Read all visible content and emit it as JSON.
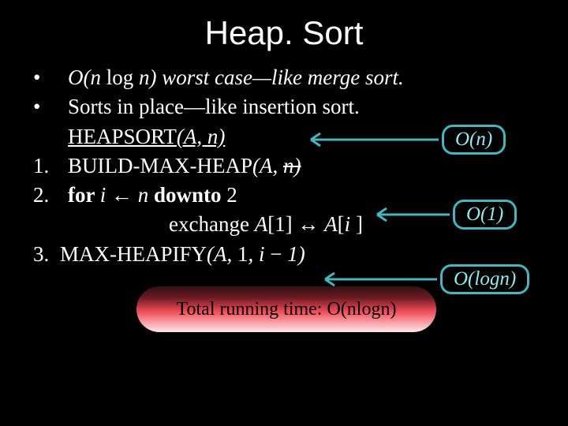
{
  "title": "Heap. Sort",
  "lines": {
    "b1_pre": "O(n ",
    "b1_log": "log ",
    "b1_post": "n) worst case—like merge sort.",
    "b2": "Sorts in place—like insertion sort.",
    "hsort_pre": "HEAPSORT",
    "hsort_post": "(A, n)",
    "l1_num": "1.",
    "l1_pre": "BUILD-MAX-HEAP",
    "l1_paren": "(A, ",
    "l1_strike": "n)",
    "l2_num": "2.",
    "l2_pre": "for ",
    "l2_i": "i ",
    "l2_arrow": "← ",
    "l2_n": "n ",
    "l2_down": "downto ",
    "l2_two": "2",
    "l2b_pre": "exchange ",
    "l2b_a1": "A",
    "l2b_br1": "[1] ↔ ",
    "l2b_a2": "A",
    "l2b_br2": "[",
    "l2b_i": "i ",
    "l2b_br3": "]",
    "l3_num": "3.",
    "l3_pre": "MAX-HEAPIFY",
    "l3_paren": "(A, ",
    "l3_one": "1",
    "l3_comma": ", ",
    "l3_i": "i ",
    "l3_minus": "− ",
    "l3_tail": "1)"
  },
  "annotations": {
    "a1": "O(n)",
    "a2": "O(1)",
    "a3": "O(logn)"
  },
  "footer": "Total running time: O(nlogn)"
}
